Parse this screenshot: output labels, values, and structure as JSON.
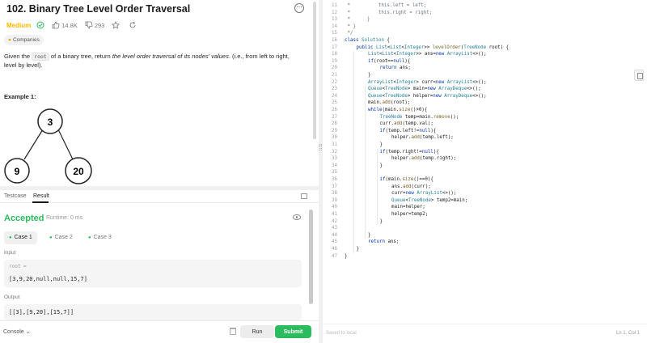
{
  "problem": {
    "title": "102. Binary Tree Level Order Traversal",
    "difficulty": "Medium",
    "likes": "14.8K",
    "dislikes": "293",
    "companies_label": "Companies",
    "description_pre": "Given the ",
    "description_code": "root",
    "description_mid": " of a binary tree, return ",
    "description_em": "the level order traversal of its nodes' values",
    "description_post": ". (i.e., from left to right, level by level).",
    "example_title": "Example 1:",
    "tree_nodes": [
      "3",
      "9",
      "20"
    ]
  },
  "result": {
    "tabs": [
      "Testcase",
      "Result"
    ],
    "status": "Accepted",
    "runtime": "Runtime: 0 ms",
    "cases": [
      "Case 1",
      "Case 2",
      "Case 3"
    ],
    "input_label": "Input",
    "input_var": "root =",
    "input_value": "[3,9,20,null,null,15,7]",
    "output_label": "Output",
    "output_value": "[[3],[9,20],[15,7]]"
  },
  "bottombar": {
    "console_label": "Console",
    "run_label": "Run",
    "submit_label": "Submit"
  },
  "editor": {
    "saved_text": "Saved to local",
    "cursor_pos": "Ln 1, Col 1",
    "lines": [
      {
        "n": "11",
        "i": 0,
        "parts": [
          {
            "c": "cm",
            "t": " *          this.left = left;"
          }
        ]
      },
      {
        "n": "12",
        "i": 0,
        "parts": [
          {
            "c": "cm",
            "t": " *          this.right = right;"
          }
        ]
      },
      {
        "n": "13",
        "i": 0,
        "parts": [
          {
            "c": "cm",
            "t": " *      }"
          }
        ]
      },
      {
        "n": "14",
        "i": 0,
        "parts": [
          {
            "c": "cm",
            "t": " * }"
          }
        ]
      },
      {
        "n": "15",
        "i": 0,
        "parts": [
          {
            "c": "cm",
            "t": " */"
          }
        ]
      },
      {
        "n": "16",
        "i": 0,
        "parts": [
          {
            "c": "kw",
            "t": "class "
          },
          {
            "c": "ty",
            "t": "Solution"
          },
          {
            "c": "tx",
            "t": " {"
          }
        ]
      },
      {
        "n": "17",
        "i": 1,
        "parts": [
          {
            "c": "kw",
            "t": "public "
          },
          {
            "c": "ty",
            "t": "List"
          },
          {
            "c": "tx",
            "t": "<"
          },
          {
            "c": "ty",
            "t": "List"
          },
          {
            "c": "tx",
            "t": "<"
          },
          {
            "c": "ty",
            "t": "Integer"
          },
          {
            "c": "tx",
            "t": ">> "
          },
          {
            "c": "fn",
            "t": "levelOrder"
          },
          {
            "c": "tx",
            "t": "("
          },
          {
            "c": "ty",
            "t": "TreeNode"
          },
          {
            "c": "tx",
            "t": " root) {"
          }
        ]
      },
      {
        "n": "18",
        "i": 2,
        "parts": [
          {
            "c": "ty",
            "t": "List"
          },
          {
            "c": "tx",
            "t": "<"
          },
          {
            "c": "ty",
            "t": "List"
          },
          {
            "c": "tx",
            "t": "<"
          },
          {
            "c": "ty",
            "t": "Integer"
          },
          {
            "c": "tx",
            "t": ">> ans="
          },
          {
            "c": "kw",
            "t": "new "
          },
          {
            "c": "ty",
            "t": "ArrayList"
          },
          {
            "c": "tx",
            "t": "<>();"
          }
        ]
      },
      {
        "n": "19",
        "i": 2,
        "parts": [
          {
            "c": "kw",
            "t": "if"
          },
          {
            "c": "tx",
            "t": "(root=="
          },
          {
            "c": "kw",
            "t": "null"
          },
          {
            "c": "tx",
            "t": "){"
          }
        ]
      },
      {
        "n": "20",
        "i": 3,
        "parts": [
          {
            "c": "kw",
            "t": "return "
          },
          {
            "c": "tx",
            "t": "ans;"
          }
        ]
      },
      {
        "n": "21",
        "i": 2,
        "parts": [
          {
            "c": "tx",
            "t": "}"
          }
        ]
      },
      {
        "n": "22",
        "i": 2,
        "parts": [
          {
            "c": "ty",
            "t": "ArrayList"
          },
          {
            "c": "tx",
            "t": "<"
          },
          {
            "c": "ty",
            "t": "Integer"
          },
          {
            "c": "tx",
            "t": "> curr="
          },
          {
            "c": "kw",
            "t": "new "
          },
          {
            "c": "ty",
            "t": "ArrayList"
          },
          {
            "c": "tx",
            "t": "<>();"
          }
        ]
      },
      {
        "n": "23",
        "i": 2,
        "parts": [
          {
            "c": "ty",
            "t": "Queue"
          },
          {
            "c": "tx",
            "t": "<"
          },
          {
            "c": "ty",
            "t": "TreeNode"
          },
          {
            "c": "tx",
            "t": "> main="
          },
          {
            "c": "kw",
            "t": "new "
          },
          {
            "c": "ty",
            "t": "ArrayDeque"
          },
          {
            "c": "tx",
            "t": "<>();"
          }
        ]
      },
      {
        "n": "24",
        "i": 2,
        "parts": [
          {
            "c": "ty",
            "t": "Queue"
          },
          {
            "c": "tx",
            "t": "<"
          },
          {
            "c": "ty",
            "t": "TreeNode"
          },
          {
            "c": "tx",
            "t": "> helper="
          },
          {
            "c": "kw",
            "t": "new "
          },
          {
            "c": "ty",
            "t": "ArrayDeque"
          },
          {
            "c": "tx",
            "t": "<>();"
          }
        ]
      },
      {
        "n": "25",
        "i": 2,
        "parts": [
          {
            "c": "tx",
            "t": "main."
          },
          {
            "c": "fn",
            "t": "add"
          },
          {
            "c": "tx",
            "t": "(root);"
          }
        ]
      },
      {
        "n": "26",
        "i": 2,
        "parts": [
          {
            "c": "kw",
            "t": "while"
          },
          {
            "c": "tx",
            "t": "(main."
          },
          {
            "c": "fn",
            "t": "size"
          },
          {
            "c": "tx",
            "t": "()>0){"
          }
        ]
      },
      {
        "n": "27",
        "i": 3,
        "parts": [
          {
            "c": "ty",
            "t": "TreeNode"
          },
          {
            "c": "tx",
            "t": " temp=main."
          },
          {
            "c": "fn",
            "t": "remove"
          },
          {
            "c": "tx",
            "t": "();"
          }
        ]
      },
      {
        "n": "28",
        "i": 3,
        "parts": [
          {
            "c": "tx",
            "t": "curr."
          },
          {
            "c": "fn",
            "t": "add"
          },
          {
            "c": "tx",
            "t": "(temp.val);"
          }
        ]
      },
      {
        "n": "29",
        "i": 3,
        "parts": [
          {
            "c": "kw",
            "t": "if"
          },
          {
            "c": "tx",
            "t": "(temp.left!="
          },
          {
            "c": "kw",
            "t": "null"
          },
          {
            "c": "tx",
            "t": "){"
          }
        ]
      },
      {
        "n": "30",
        "i": 4,
        "parts": [
          {
            "c": "tx",
            "t": "helper."
          },
          {
            "c": "fn",
            "t": "add"
          },
          {
            "c": "tx",
            "t": "(temp.left);"
          }
        ]
      },
      {
        "n": "31",
        "i": 3,
        "parts": [
          {
            "c": "tx",
            "t": "}"
          }
        ]
      },
      {
        "n": "32",
        "i": 3,
        "parts": [
          {
            "c": "kw",
            "t": "if"
          },
          {
            "c": "tx",
            "t": "(temp.right!="
          },
          {
            "c": "kw",
            "t": "null"
          },
          {
            "c": "tx",
            "t": "){"
          }
        ]
      },
      {
        "n": "33",
        "i": 4,
        "parts": [
          {
            "c": "tx",
            "t": "helper."
          },
          {
            "c": "fn",
            "t": "add"
          },
          {
            "c": "tx",
            "t": "(temp.right);"
          }
        ]
      },
      {
        "n": "34",
        "i": 3,
        "parts": [
          {
            "c": "tx",
            "t": "}"
          }
        ]
      },
      {
        "n": "35",
        "i": 0,
        "parts": []
      },
      {
        "n": "36",
        "i": 3,
        "parts": [
          {
            "c": "kw",
            "t": "if"
          },
          {
            "c": "tx",
            "t": "(main."
          },
          {
            "c": "fn",
            "t": "size"
          },
          {
            "c": "tx",
            "t": "()==0){"
          }
        ]
      },
      {
        "n": "37",
        "i": 4,
        "parts": [
          {
            "c": "tx",
            "t": "ans."
          },
          {
            "c": "fn",
            "t": "add"
          },
          {
            "c": "tx",
            "t": "(curr);"
          }
        ]
      },
      {
        "n": "38",
        "i": 4,
        "parts": [
          {
            "c": "tx",
            "t": "curr="
          },
          {
            "c": "kw",
            "t": "new "
          },
          {
            "c": "ty",
            "t": "ArrayList"
          },
          {
            "c": "tx",
            "t": "<>();"
          }
        ]
      },
      {
        "n": "39",
        "i": 4,
        "parts": [
          {
            "c": "ty",
            "t": "Queue"
          },
          {
            "c": "tx",
            "t": "<"
          },
          {
            "c": "ty",
            "t": "TreeNode"
          },
          {
            "c": "tx",
            "t": "> temp2=main;"
          }
        ]
      },
      {
        "n": "40",
        "i": 4,
        "parts": [
          {
            "c": "tx",
            "t": "main=helper;"
          }
        ]
      },
      {
        "n": "41",
        "i": 4,
        "parts": [
          {
            "c": "tx",
            "t": "helper=temp2;"
          }
        ]
      },
      {
        "n": "42",
        "i": 3,
        "parts": [
          {
            "c": "tx",
            "t": "}"
          }
        ]
      },
      {
        "n": "43",
        "i": 0,
        "parts": []
      },
      {
        "n": "44",
        "i": 2,
        "parts": [
          {
            "c": "tx",
            "t": "}"
          }
        ]
      },
      {
        "n": "45",
        "i": 2,
        "parts": [
          {
            "c": "kw",
            "t": "return "
          },
          {
            "c": "tx",
            "t": "ans;"
          }
        ]
      },
      {
        "n": "46",
        "i": 1,
        "parts": [
          {
            "c": "tx",
            "t": "}"
          }
        ]
      },
      {
        "n": "47",
        "i": 0,
        "parts": [
          {
            "c": "tx",
            "t": "}"
          }
        ]
      }
    ]
  },
  "colors": {
    "accent_green": "#2cbb5d",
    "medium_yellow": "#ffb800"
  },
  "icons": [
    "solved-check-icon",
    "thumbs-up-icon",
    "thumbs-down-icon",
    "star-icon",
    "share-icon",
    "tag-icon",
    "eye-icon",
    "trash-icon",
    "file-icon",
    "more-icon"
  ]
}
